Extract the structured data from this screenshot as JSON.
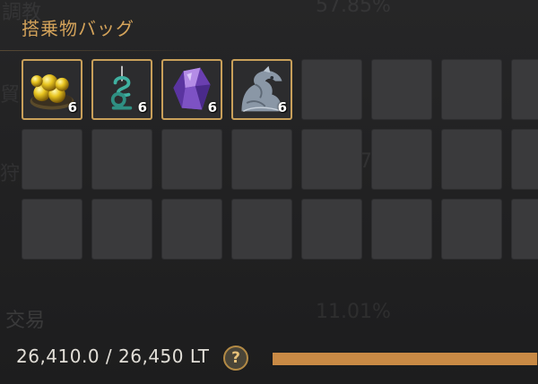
{
  "window": {
    "title": "搭乗物バッグ",
    "accent_color": "#c9a05a"
  },
  "background_ghost_text": {
    "line1": "57.85%",
    "line2": "22.97%",
    "line3": "11.01%",
    "left1": "調教",
    "left2": "貿",
    "left3": "狩",
    "left4": "交易"
  },
  "inventory": {
    "columns": 8,
    "rows": 3,
    "items": [
      {
        "name": "gold-eggs-icon",
        "count": "6"
      },
      {
        "name": "teal-key-icon",
        "count": "6"
      },
      {
        "name": "purple-crystal-icon",
        "count": "6"
      },
      {
        "name": "dragon-statue-icon",
        "count": "6"
      }
    ]
  },
  "weight": {
    "text": "26,410.0 / 26,450 LT",
    "fill_percent": 99.8,
    "help_label": "?"
  }
}
